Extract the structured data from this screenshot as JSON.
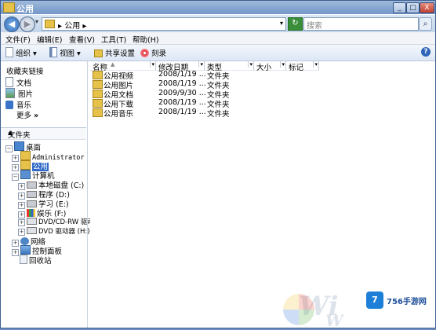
{
  "window": {
    "title": "公用",
    "minimize": "_",
    "maximize": "□",
    "close": "X"
  },
  "address": {
    "path_sep": "▸",
    "path": "公用",
    "dropdown": "▾",
    "refresh": "↻",
    "search_placeholder": "搜索",
    "back": "◀",
    "forward": "▶",
    "nav_dropdown": "▾"
  },
  "menu": [
    {
      "label": "文件(F)"
    },
    {
      "label": "编辑(E)"
    },
    {
      "label": "查看(V)"
    },
    {
      "label": "工具(T)"
    },
    {
      "label": "帮助(H)"
    }
  ],
  "toolbar": {
    "organize": "组织",
    "views": "视图",
    "share": "共享设置",
    "burn": "刻录",
    "organize_dd": "▾",
    "views_dd": "▾",
    "help": "?"
  },
  "favorites": {
    "header": "收藏夹链接",
    "items": [
      {
        "label": "文档"
      },
      {
        "label": "图片"
      },
      {
        "label": "音乐"
      }
    ],
    "more": "更多",
    "more_arrow": "»"
  },
  "folders": {
    "header": "文件夹",
    "chevron": "▲"
  },
  "tree": [
    {
      "label": "桌面",
      "pm": "−"
    },
    {
      "label": "Administrator",
      "pm": "+"
    },
    {
      "label": "公用",
      "pm": "+"
    },
    {
      "label": "计算机",
      "pm": "−"
    },
    {
      "label": "本地磁盘 (C:)",
      "pm": "+"
    },
    {
      "label": "程序 (D:)",
      "pm": "+"
    },
    {
      "label": "学习 (E:)",
      "pm": "+"
    },
    {
      "label": "娱乐 (F:)",
      "pm": "+"
    },
    {
      "label": "DVD/CD-RW 驱动器",
      "pm": "+"
    },
    {
      "label": "DVD 驱动器 (H:)",
      "pm": "+"
    },
    {
      "label": "网络",
      "pm": "+"
    },
    {
      "label": "控制面板",
      "pm": "+"
    },
    {
      "label": "回收站",
      "pm": ""
    }
  ],
  "columns": [
    {
      "label": "名称",
      "sort": "▲"
    },
    {
      "label": "修改日期"
    },
    {
      "label": "类型"
    },
    {
      "label": "大小"
    },
    {
      "label": "标记"
    }
  ],
  "files": [
    {
      "name": "公用视频",
      "date": "2008/1/19 ...",
      "type": "文件夹"
    },
    {
      "name": "公用图片",
      "date": "2008/1/19 ...",
      "type": "文件夹"
    },
    {
      "name": "公用文档",
      "date": "2009/9/30 ...",
      "type": "文件夹"
    },
    {
      "name": "公用下载",
      "date": "2008/1/19 ...",
      "type": "文件夹"
    },
    {
      "name": "公用音乐",
      "date": "2008/1/19 ...",
      "type": "文件夹"
    }
  ],
  "watermark": {
    "logo_text": "756手游网",
    "logo_badge": "7"
  }
}
